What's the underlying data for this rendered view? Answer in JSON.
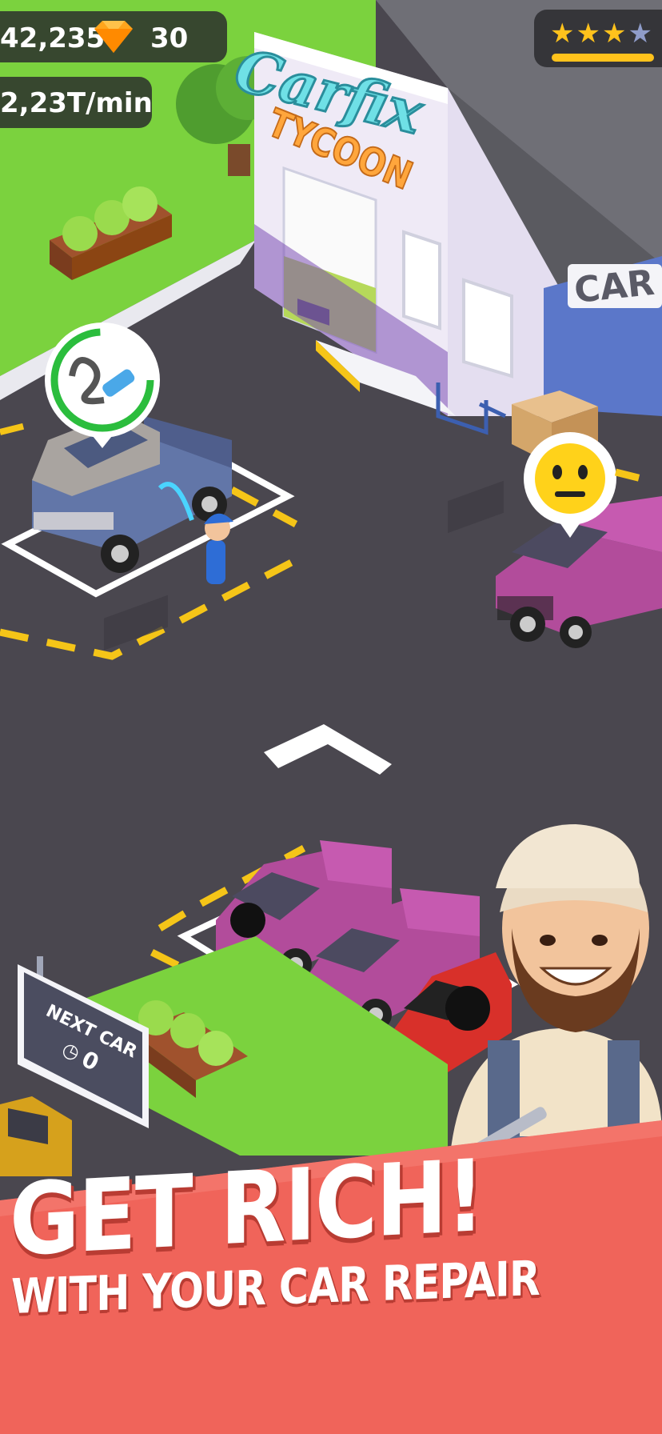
{
  "hud": {
    "cash": "42,235",
    "gem_icon": "diamond-gem-icon",
    "gems": "30",
    "income_rate": "2,23T/min",
    "rating_stars": "★★★",
    "rating_dim_star": "★",
    "rating_filled": 3,
    "rating_total": 4
  },
  "scene": {
    "logo_script": "Carfix",
    "logo_word": "TYCOON",
    "side_sign": "CAR",
    "next_car_title": "NEXT CAR",
    "next_car_count": "0",
    "wash_task_icon": "water-hose-icon",
    "customer_mood_icon": "neutral-face-icon"
  },
  "promo": {
    "headline": "GET RICH!",
    "subline": "WITH YOUR CAR REPAIR"
  },
  "colors": {
    "grass": "#7bd23e",
    "asphalt": "#4a474f",
    "parking_line": "#f5c518",
    "banner": "#f0645a",
    "pickup_pink": "#b24c9b",
    "hud_bg": "#28282c"
  }
}
